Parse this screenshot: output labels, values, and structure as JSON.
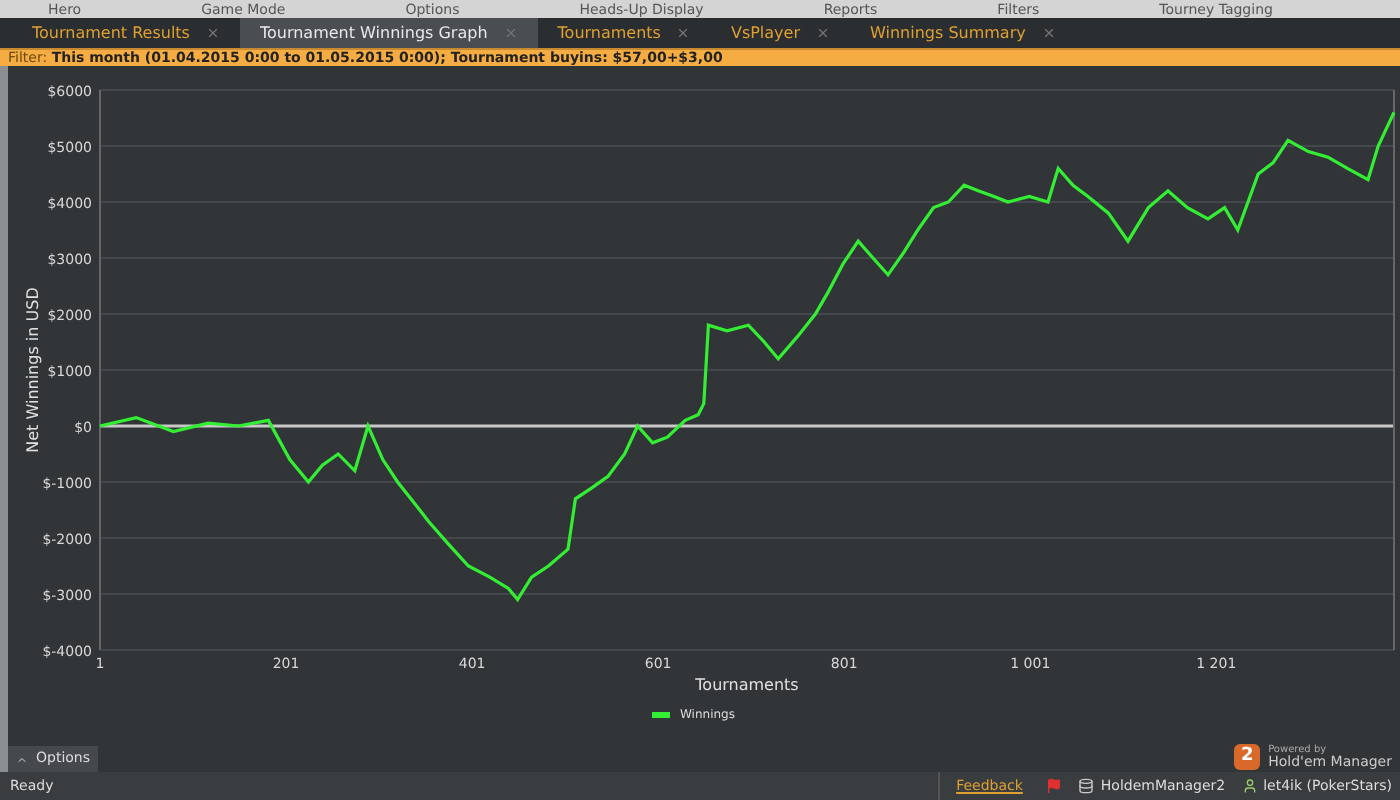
{
  "menu": [
    "Hero",
    "Game Mode",
    "Options",
    "Heads-Up Display",
    "Reports",
    "Filters",
    "Tourney Tagging"
  ],
  "tabs": [
    {
      "label": "Tournament Results",
      "selected": false
    },
    {
      "label": "Tournament Winnings Graph",
      "selected": true
    },
    {
      "label": "Tournaments",
      "selected": false
    },
    {
      "label": "VsPlayer",
      "selected": false
    },
    {
      "label": "Winnings Summary",
      "selected": false
    }
  ],
  "filter": {
    "label": "Filter:",
    "text": "This month (01.04.2015 0:00 to 01.05.2015 0:00); Tournament buyins: $57,00+$3,00"
  },
  "chart": {
    "chart_data": {
      "type": "line",
      "grid": true,
      "xlabel": "Tournaments",
      "ylabel": "Net Winnings in USD",
      "xlim": [
        1,
        1392
      ],
      "ylim": [
        -4000,
        6000
      ],
      "xticks": [
        {
          "value": 1,
          "label": "1"
        },
        {
          "value": 201,
          "label": "201"
        },
        {
          "value": 401,
          "label": "401"
        },
        {
          "value": 601,
          "label": "601"
        },
        {
          "value": 801,
          "label": "801"
        },
        {
          "value": 1001,
          "label": "1 001"
        },
        {
          "value": 1201,
          "label": "1 201"
        }
      ],
      "yticks": [
        {
          "value": 6000,
          "label": "$6000"
        },
        {
          "value": 5000,
          "label": "$5000"
        },
        {
          "value": 4000,
          "label": "$4000"
        },
        {
          "value": 3000,
          "label": "$3000"
        },
        {
          "value": 2000,
          "label": "$2000"
        },
        {
          "value": 1000,
          "label": "$1000"
        },
        {
          "value": 0,
          "label": "$0"
        },
        {
          "value": -1000,
          "label": "$-1000"
        },
        {
          "value": -2000,
          "label": "$-2000"
        },
        {
          "value": -3000,
          "label": "$-3000"
        },
        {
          "value": -4000,
          "label": "$-4000"
        }
      ],
      "x": [
        1,
        40,
        80,
        117,
        150,
        182,
        205,
        225,
        240,
        257,
        275,
        289,
        305,
        321,
        340,
        354,
        375,
        397,
        420,
        440,
        450,
        465,
        483,
        504,
        512,
        530,
        547,
        565,
        579,
        595,
        611,
        630,
        644,
        650,
        655,
        675,
        698,
        715,
        730,
        751,
        770,
        784,
        800,
        816,
        832,
        848,
        865,
        880,
        897,
        913,
        930,
        945,
        962,
        977,
        1000,
        1020,
        1031,
        1047,
        1063,
        1085,
        1106,
        1128,
        1149,
        1170,
        1192,
        1210,
        1224,
        1246,
        1262,
        1278,
        1300,
        1321,
        1342,
        1364,
        1375,
        1392
      ],
      "series": [
        {
          "name": "Winnings",
          "color": "#33ee33",
          "values": [
            0,
            150,
            -100,
            50,
            0,
            100,
            -600,
            -1000,
            -700,
            -500,
            -800,
            0,
            -600,
            -1000,
            -1400,
            -1700,
            -2100,
            -2500,
            -2700,
            -2900,
            -3100,
            -2700,
            -2500,
            -2200,
            -1300,
            -1100,
            -900,
            -500,
            0,
            -300,
            -200,
            100,
            200,
            400,
            1800,
            1700,
            1800,
            1500,
            1200,
            1600,
            2000,
            2400,
            2900,
            3300,
            3000,
            2700,
            3100,
            3500,
            3900,
            4000,
            4300,
            4200,
            4100,
            4000,
            4100,
            4000,
            4600,
            4300,
            4100,
            3800,
            3300,
            3900,
            4200,
            3900,
            3700,
            3900,
            3500,
            4500,
            4700,
            5100,
            4900,
            4800,
            4600,
            4400,
            5000,
            5600
          ]
        }
      ]
    },
    "powered_by": "Powered by",
    "brand": "Hold'em Manager",
    "brand_badge": "2"
  },
  "options_button": "Options",
  "status_bar": {
    "status": "Ready",
    "feedback": "Feedback",
    "app": "HoldemManager2",
    "user": "let4ik (PokerStars)"
  }
}
